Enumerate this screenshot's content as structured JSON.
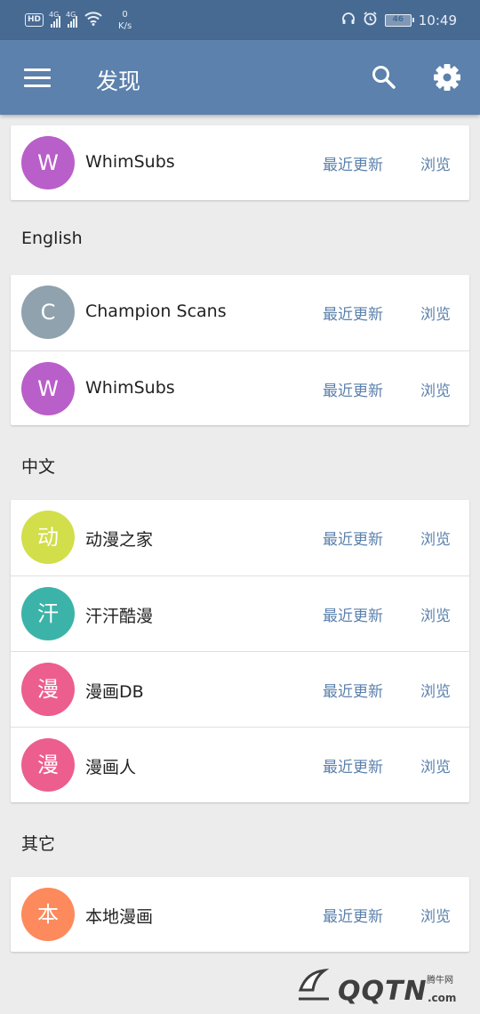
{
  "status_bar": {
    "hd": "HD",
    "net1": "4G",
    "net2": "4G",
    "speed_value": "0",
    "speed_unit": "K/s",
    "battery": "46",
    "time": "10:49"
  },
  "toolbar": {
    "title": "发现",
    "menu_icon": "hamburger-menu-icon",
    "search_icon": "search-icon",
    "settings_icon": "gear-icon"
  },
  "colors": {
    "status_bar": "#476a93",
    "toolbar": "#5b81ac",
    "action_text": "#5b81ac"
  },
  "action_labels": {
    "latest": "最近更新",
    "browse": "浏览"
  },
  "sections": [
    {
      "header": "",
      "sources": [
        {
          "initial": "W",
          "name": "WhimSubs",
          "color": "#b95fc9"
        }
      ]
    },
    {
      "header": "English",
      "sources": [
        {
          "initial": "C",
          "name": "Champion Scans",
          "color": "#8fa2ad"
        },
        {
          "initial": "W",
          "name": "WhimSubs",
          "color": "#b95fc9"
        }
      ]
    },
    {
      "header": "中文",
      "sources": [
        {
          "initial": "动",
          "name": "动漫之家",
          "color": "#d2de4a"
        },
        {
          "initial": "汗",
          "name": "汗汗酷漫",
          "color": "#3bb3a8"
        },
        {
          "initial": "漫",
          "name": "漫画DB",
          "color": "#ec5e8e"
        },
        {
          "initial": "漫",
          "name": "漫画人",
          "color": "#ec5e8e"
        }
      ]
    },
    {
      "header": "其它",
      "sources": [
        {
          "initial": "本",
          "name": "本地漫画",
          "color": "#fd8a5c"
        }
      ]
    }
  ],
  "watermark": {
    "brand": "QQTN",
    "site": "腾牛网",
    "domain": ".com"
  }
}
